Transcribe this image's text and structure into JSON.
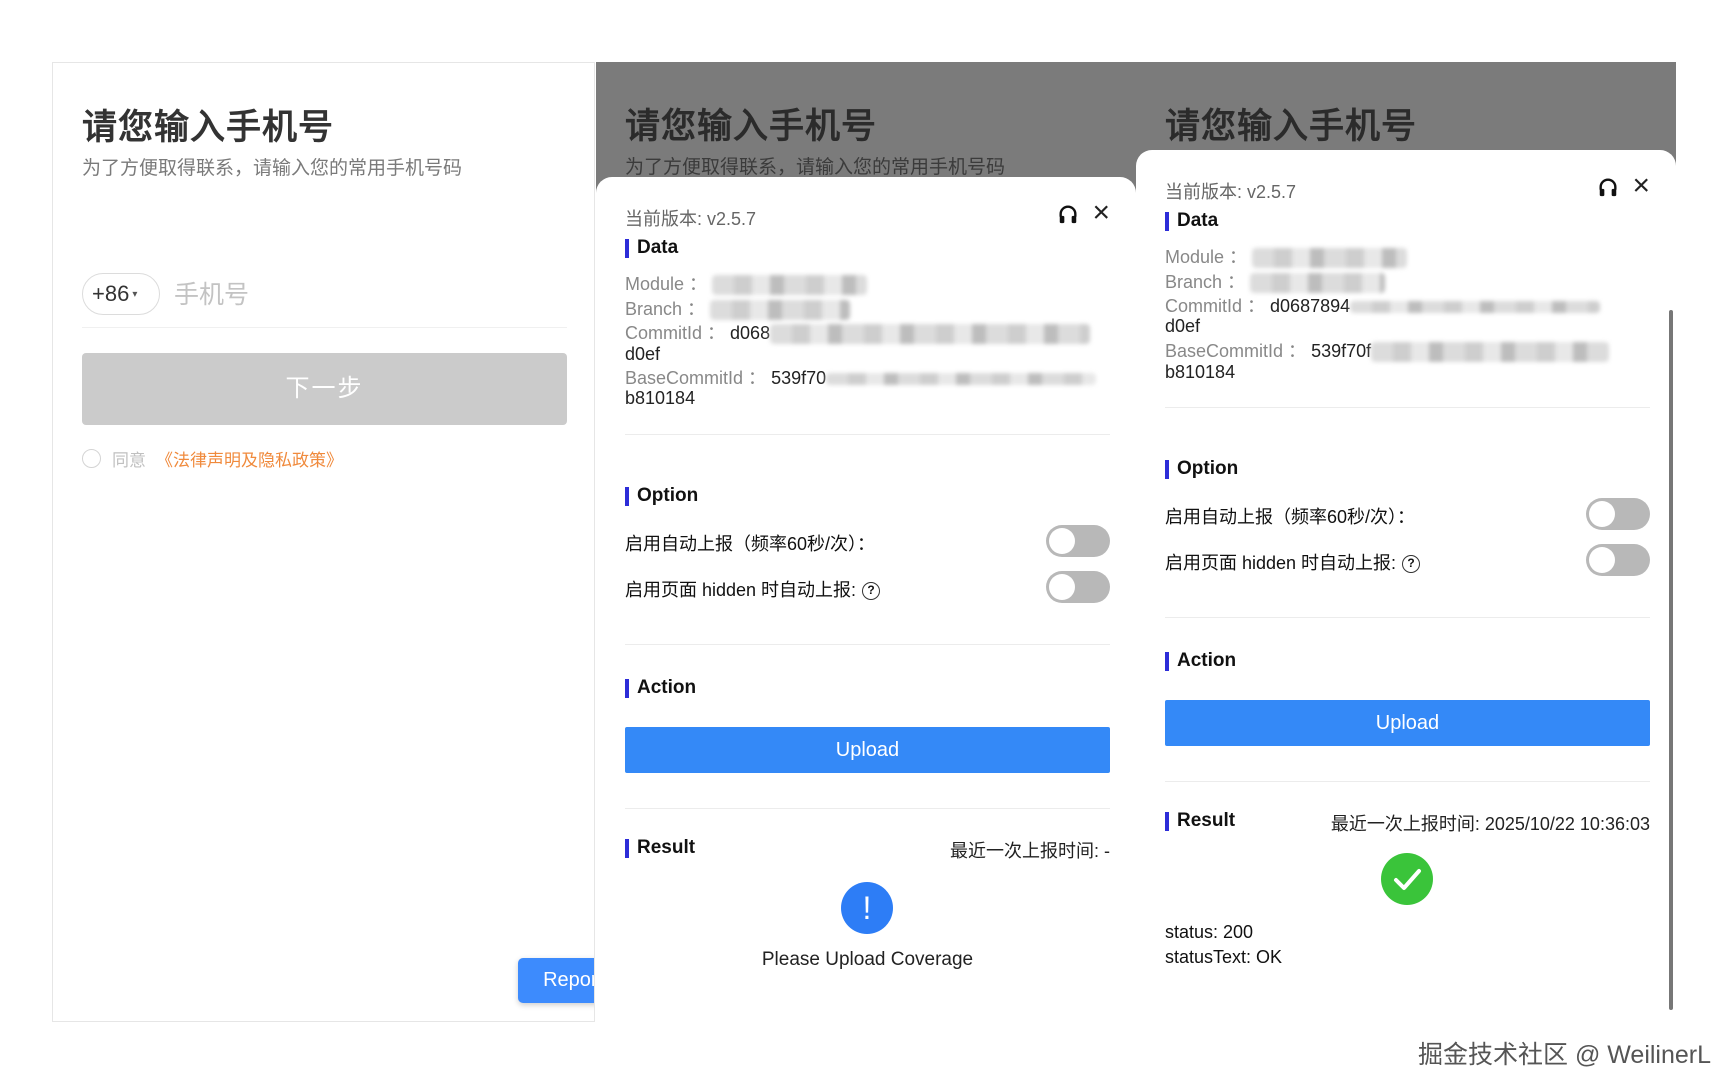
{
  "login": {
    "title": "请您输入手机号",
    "subtitle": "为了方便取得联系，请输入您的常用手机号码",
    "country_code": "+86",
    "phone_placeholder": "手机号",
    "next_label": "下一步",
    "agree_label": "同意",
    "policy_link": "《法律声明及隐私政策》",
    "reporter_label": "Reporter"
  },
  "reporter_before": {
    "version": "当前版本: v2.5.7",
    "data_title": "Data",
    "module_label": "Module ：",
    "branch_label": "Branch ：",
    "commit_label": "CommitId ：",
    "commit_value": "d068",
    "commit_tail": "d0ef",
    "base_label": "BaseCommitId ：",
    "base_value": "539f70",
    "base_tail": "b810184",
    "option_title": "Option",
    "opt_auto": "启用自动上报（频率60秒/次）：",
    "opt_hidden": "启用页面 hidden 时自动上报:",
    "action_title": "Action",
    "upload_label": "Upload",
    "result_title": "Result",
    "last_time": "最近一次上报时间: -",
    "warn_glyph": "!",
    "message": "Please Upload Coverage"
  },
  "reporter_after": {
    "version": "当前版本: v2.5.7",
    "data_title": "Data",
    "module_label": "Module ：",
    "branch_label": "Branch ：",
    "commit_label": "CommitId ：",
    "commit_value": "d0687894",
    "commit_tail": "d0ef",
    "base_label": "BaseCommitId ：",
    "base_value": "539f70f",
    "base_tail": "b810184",
    "option_title": "Option",
    "opt_auto": "启用自动上报（频率60秒/次）：",
    "opt_hidden": "启用页面 hidden 时自动上报:",
    "action_title": "Action",
    "upload_label": "Upload",
    "result_title": "Result",
    "last_time": "最近一次上报时间: 2025/10/22 10:36:03",
    "status": "status: 200",
    "status_text": "statusText: OK"
  },
  "watermark": "掘金技术社区 @ WeilinerL",
  "colors": {
    "primary": "#3489f7",
    "section_bar": "#2d2dd8",
    "policy_link": "#f08a3c",
    "success": "#3ac43a",
    "overlay": "#7b7b7b"
  },
  "icons": [
    "headset-icon",
    "close-icon",
    "help-icon",
    "warning-icon",
    "check-icon",
    "caret-down-icon"
  ]
}
